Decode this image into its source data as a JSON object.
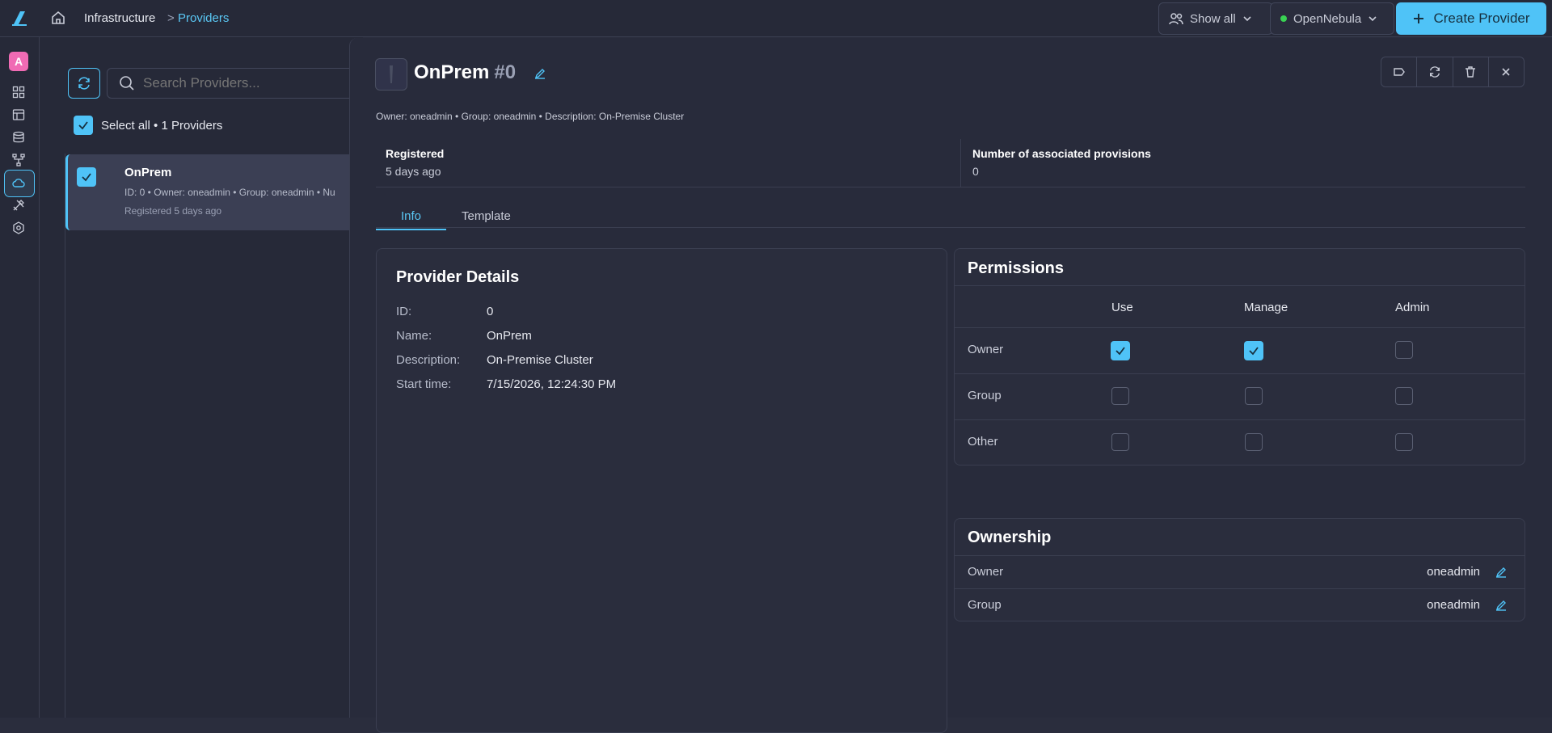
{
  "header": {
    "breadcrumb_root": "Infrastructure",
    "breadcrumb_sep": ">",
    "breadcrumb_current": "Providers",
    "show_all_label": "Show all",
    "zone_label": "OpenNebula",
    "create_label": "Create Provider"
  },
  "sidebar": {
    "avatar_letter": "A"
  },
  "list": {
    "search_placeholder": "Search Providers...",
    "select_all_label": "Select all • 1 Providers",
    "items": [
      {
        "name": "OnPrem",
        "meta": "ID: 0  •  Owner: oneadmin  •  Group: oneadmin  •  Nu",
        "sub": "Registered 5 days ago"
      }
    ]
  },
  "detail": {
    "name": "OnPrem",
    "id": "#0",
    "meta": "Owner: oneadmin  •  Group: oneadmin  •  Description: On-Premise Cluster",
    "stats": [
      {
        "label": "Registered",
        "value": "5 days ago"
      },
      {
        "label": "Number of associated provisions",
        "value": "0"
      }
    ],
    "tabs": [
      "Info",
      "Template"
    ],
    "provider_details": {
      "title": "Provider Details",
      "rows": [
        {
          "label": "ID:",
          "value": "0"
        },
        {
          "label": "Name:",
          "value": "OnPrem"
        },
        {
          "label": "Description:",
          "value": "On-Premise Cluster"
        },
        {
          "label": "Start time:",
          "value": "7/15/2026, 12:24:30 PM"
        }
      ]
    },
    "permissions": {
      "title": "Permissions",
      "columns": [
        "Use",
        "Manage",
        "Admin"
      ],
      "rows": [
        {
          "label": "Owner",
          "use": true,
          "manage": true,
          "admin": false
        },
        {
          "label": "Group",
          "use": false,
          "manage": false,
          "admin": false
        },
        {
          "label": "Other",
          "use": false,
          "manage": false,
          "admin": false
        }
      ]
    },
    "ownership": {
      "title": "Ownership",
      "rows": [
        {
          "label": "Owner",
          "value": "oneadmin"
        },
        {
          "label": "Group",
          "value": "oneadmin"
        }
      ]
    }
  },
  "colors": {
    "accent": "#4fc3f7",
    "status_dot": "#39d353",
    "avatar": "#f06bb4"
  }
}
